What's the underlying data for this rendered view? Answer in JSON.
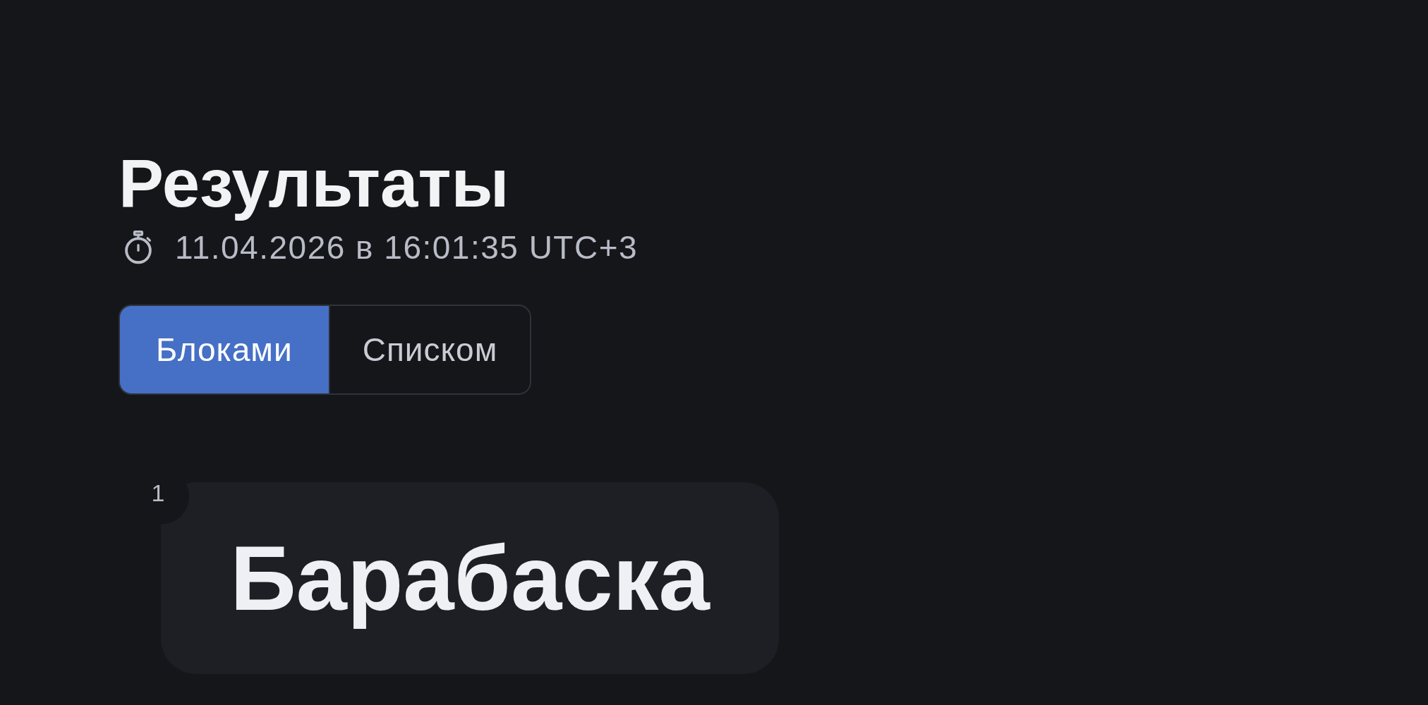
{
  "header": {
    "title": "Результаты",
    "timestamp": "11.04.2026 в 16:01:35 UTC+3"
  },
  "view_tabs": [
    {
      "label": "Блоками",
      "selected": true
    },
    {
      "label": "Списком",
      "selected": false
    }
  ],
  "results": [
    {
      "rank": "1",
      "name": "Барабаска"
    }
  ]
}
